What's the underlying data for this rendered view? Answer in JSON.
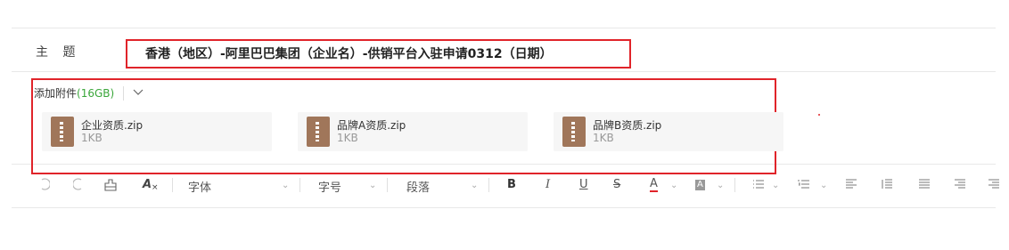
{
  "subject": {
    "label": "主 题",
    "value": "香港（地区）-阿里巴巴集团（企业名）-供销平台入驻申请0312（日期）"
  },
  "attachments": {
    "add_label": "添加附件",
    "quota": "(16GB)",
    "files": [
      {
        "name": "企业资质.zip",
        "size": "1KB"
      },
      {
        "name": "品牌A资质.zip",
        "size": "1KB"
      },
      {
        "name": "品牌B资质.zip",
        "size": "1KB"
      }
    ]
  },
  "toolbar": {
    "font_label": "字体",
    "size_label": "字号",
    "paragraph_label": "段落",
    "bold": "B",
    "italic": "I",
    "underline": "U",
    "strike": "S",
    "font_color": "A",
    "bg_color": "A",
    "clear_format": "A"
  },
  "colors": {
    "highlight": "#e0242a",
    "quota": "#3aa63a",
    "zip_icon": "#a0765a"
  }
}
